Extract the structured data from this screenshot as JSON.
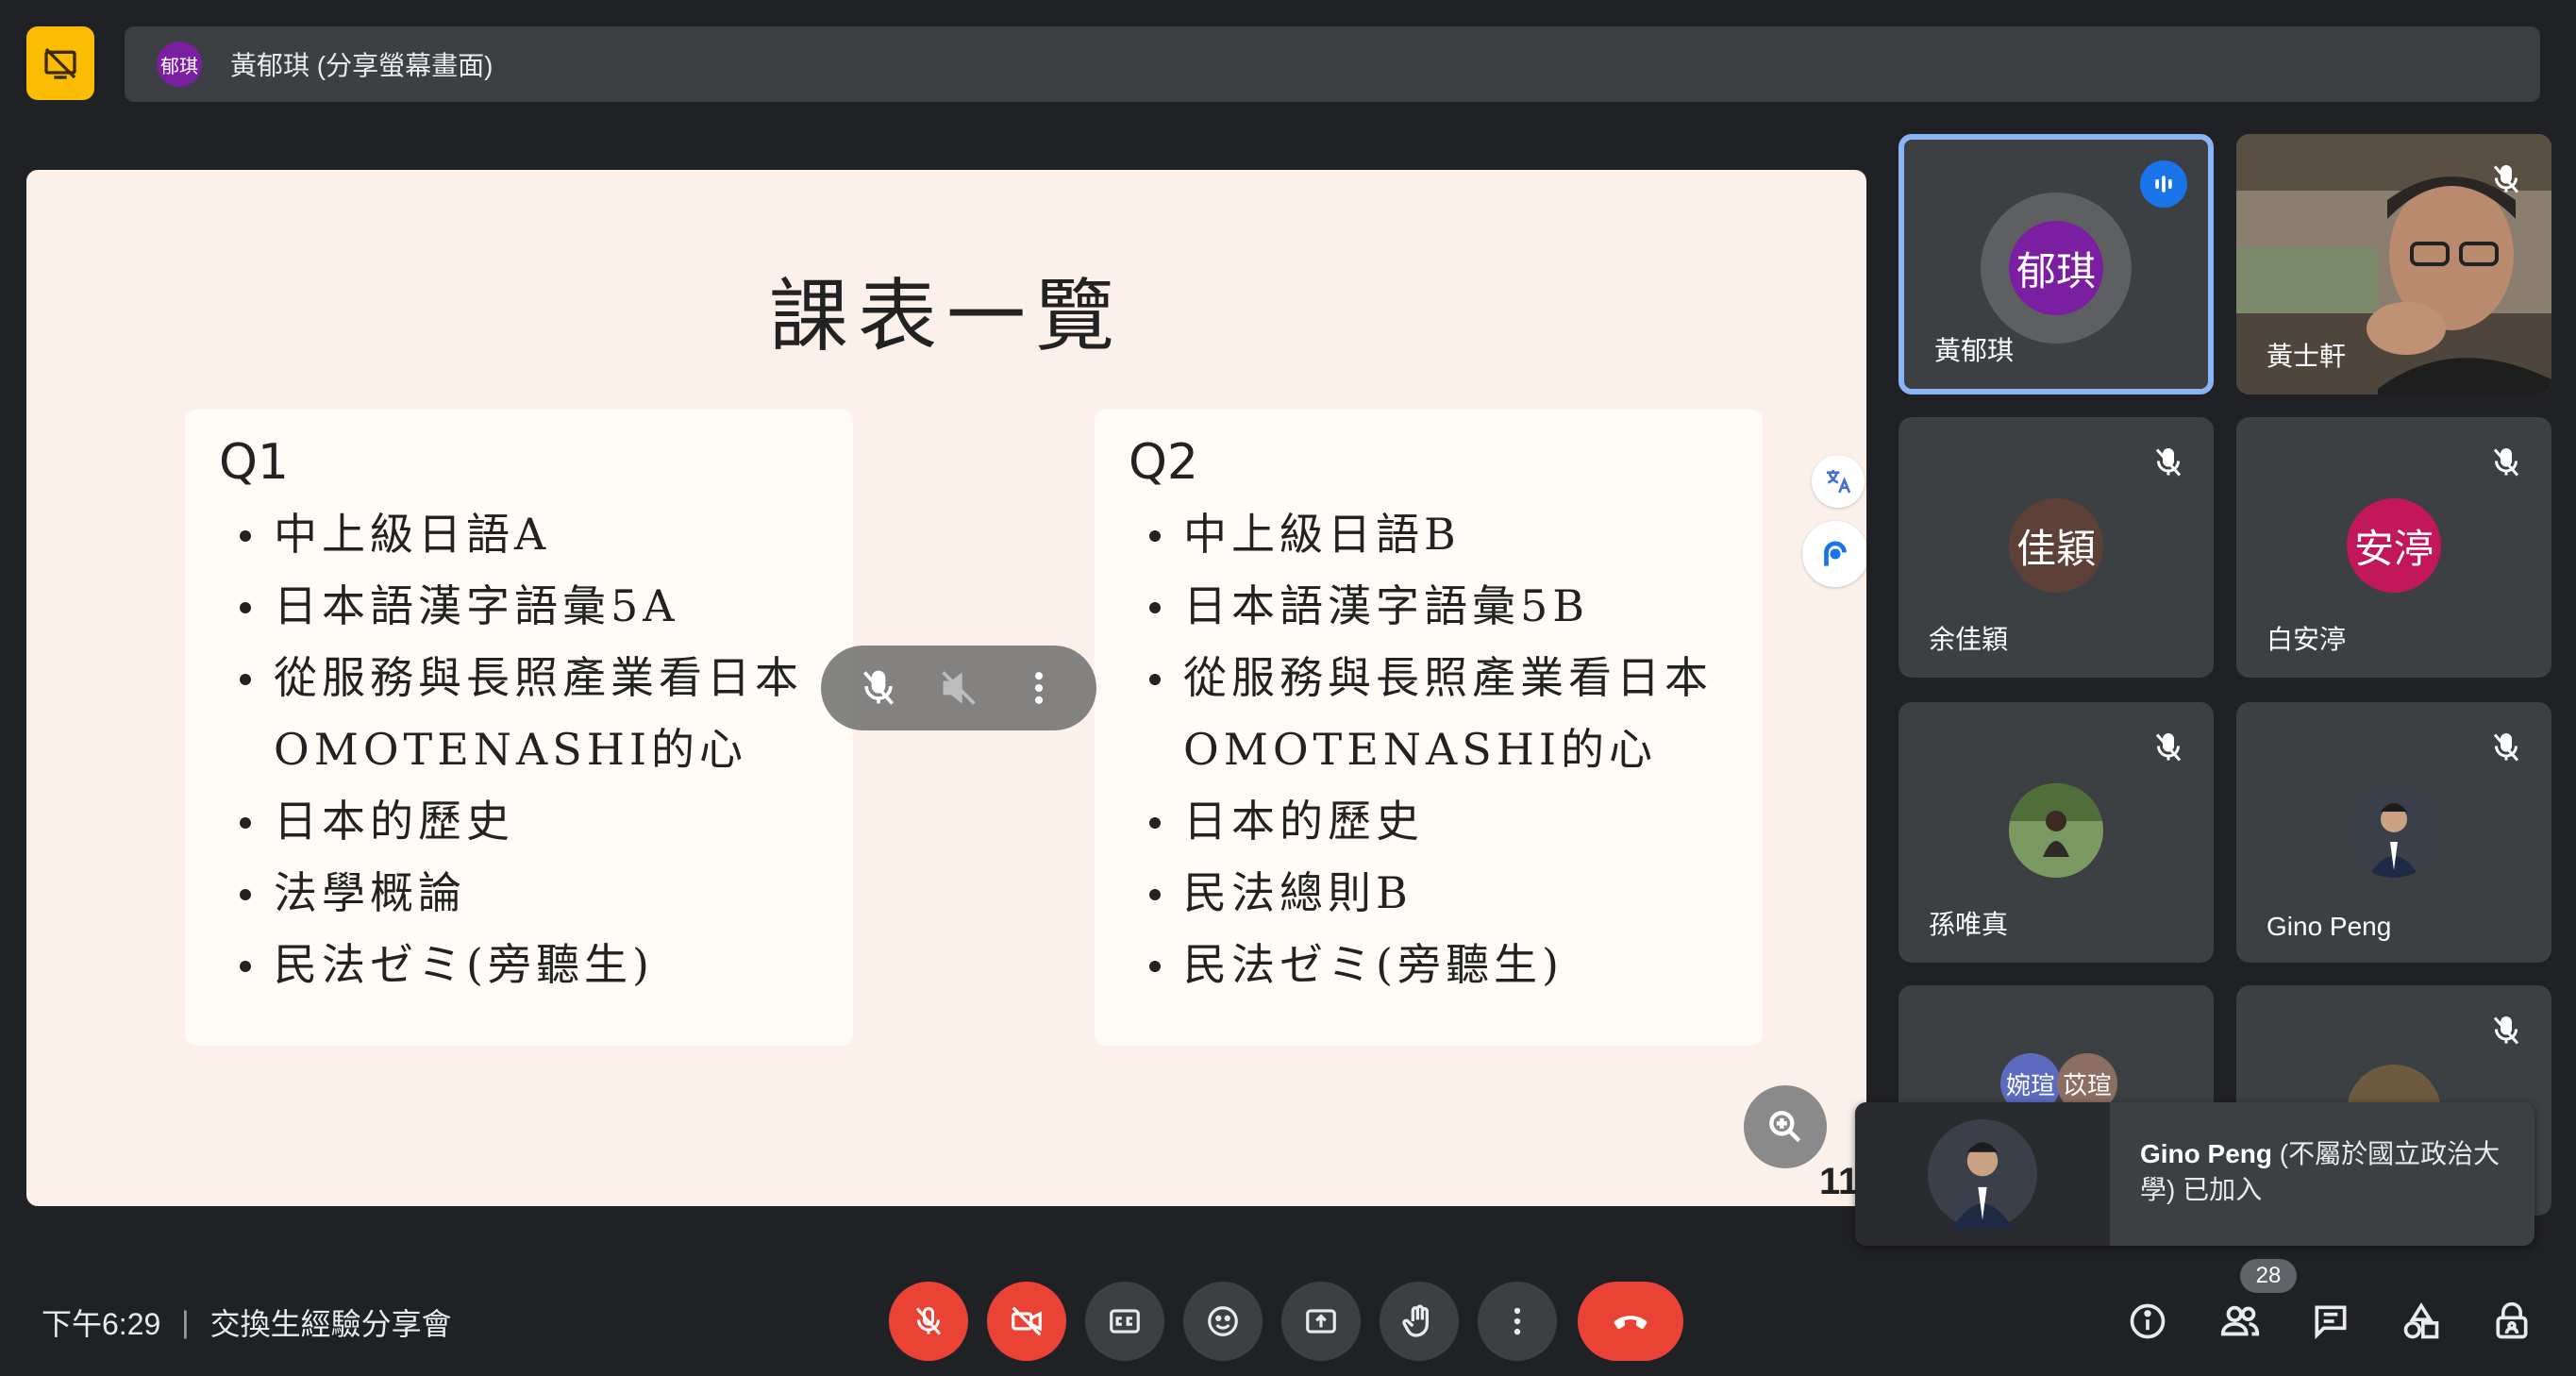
{
  "presentation_bar": {
    "avatar_initials": "郁琪",
    "text": "黃郁琪 (分享螢幕畫面)"
  },
  "slide": {
    "title": "課表一覽",
    "q1": {
      "label": "Q1",
      "items": [
        "中上級日語A",
        "日本語漢字語彙5A",
        "從服務與長照產業看日本\nOMOTENASHI的心",
        "日本的歷史",
        "法學概論",
        "民法ゼミ(旁聽生)"
      ]
    },
    "q2": {
      "label": "Q2",
      "items": [
        "中上級日語B",
        "日本語漢字語彙5B",
        "從服務與長照產業看日本\nOMOTENASHI的心",
        "日本的歷史",
        "民法總則B",
        "民法ゼミ(旁聽生)"
      ]
    },
    "page_number": "11"
  },
  "participants": [
    {
      "name": "黃郁琪",
      "initials": "郁琪",
      "color": "#7b1fa2",
      "speaking": true
    },
    {
      "name": "黃士軒",
      "video": true
    },
    {
      "name": "余佳穎",
      "initials": "佳穎",
      "color": "#5d4037"
    },
    {
      "name": "白安渟",
      "initials": "安渟",
      "color": "#c2185b"
    },
    {
      "name": "孫唯真",
      "photo": true
    },
    {
      "name": "Gino Peng",
      "photo": true
    },
    {
      "initials_a": "婉瑄",
      "initials_b": "苡瑄"
    }
  ],
  "toast": {
    "name": "Gino Peng",
    "message": " (不屬於國立政治大學) 已加入"
  },
  "meeting": {
    "time": "下午6:29",
    "title": "交換生經驗分享會",
    "participant_count": "28"
  },
  "colors": {
    "red": "#ea4335",
    "present_yellow": "#fbbc04",
    "active_border": "#8ab4f8"
  }
}
